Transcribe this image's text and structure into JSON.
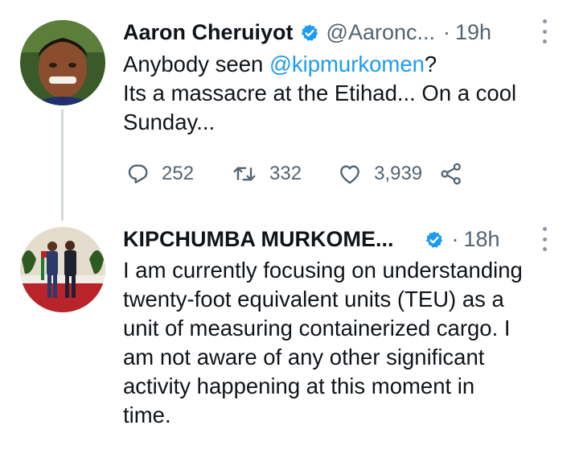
{
  "tweet1": {
    "author": "Aaron Cheruiyot",
    "handle": "@Aaronc...",
    "dot": "·",
    "time": "19h",
    "body_prefix": "Anybody seen ",
    "mention": "@kipmurkomen",
    "body_suffix": "?",
    "body_line2": "Its a massacre at the Etihad... On a cool",
    "body_line3": "Sunday...",
    "replies": "252",
    "retweets": "332",
    "likes": "3,939"
  },
  "tweet2": {
    "author": "KIPCHUMBA MURKOME...",
    "dot": "·",
    "time": "18h",
    "body_lines": [
      "I am currently focusing on understanding",
      "twenty-foot equivalent units (TEU) as a",
      "unit of measuring containerized cargo. I",
      "am not aware of any other significant",
      "activity happening at this moment in",
      "time."
    ]
  },
  "colors": {
    "accent": "#1d9bf0",
    "secondary": "#536471",
    "thread_line": "#cfd9de"
  },
  "icons": [
    "verified-badge-icon",
    "reply-icon",
    "retweet-icon",
    "like-icon",
    "share-icon",
    "more-options-icon"
  ]
}
